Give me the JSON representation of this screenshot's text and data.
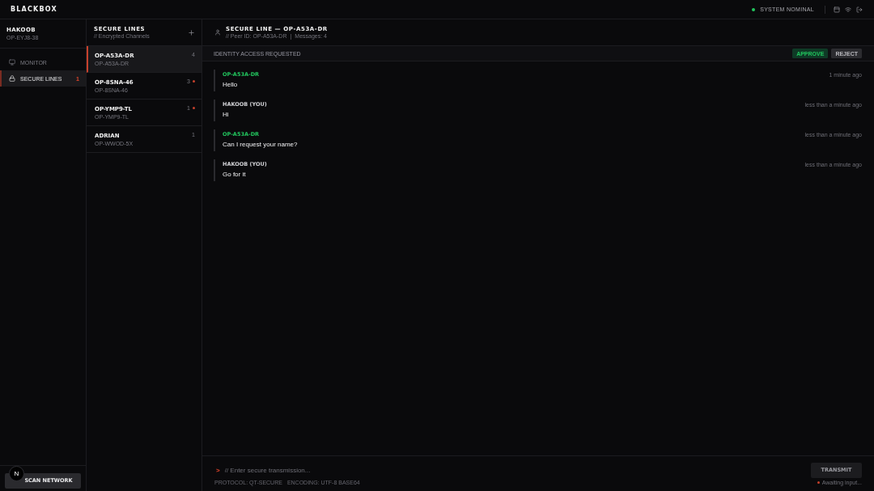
{
  "top_bar": {
    "logo": "BLACKBOX",
    "status": "SYSTEM NOMINAL"
  },
  "user": {
    "name": "HAKOOB",
    "id": "OP-EYJ8-38"
  },
  "nav": [
    {
      "label": "MONITOR",
      "kind": "monitor",
      "selected": false
    },
    {
      "label": "SECURE LINES",
      "kind": "lock",
      "selected": true,
      "badge": "1"
    }
  ],
  "scan_button": "SCAN NETWORK",
  "dev_indicator": "N",
  "channels": {
    "title": "SECURE LINES",
    "subtitle": "// Encrypted Channels",
    "items": [
      {
        "name": "OP-A53A-DR",
        "peer_id": "OP-A53A-DR",
        "count": "4",
        "unread": false,
        "selected": true
      },
      {
        "name": "OP-8SNA-46",
        "peer_id": "OP-8SNA-46",
        "count": "3",
        "unread": true,
        "selected": false
      },
      {
        "name": "OP-YMP9-TL",
        "peer_id": "OP-YMP9-TL",
        "count": "1",
        "unread": true,
        "selected": false
      },
      {
        "name": "ADRIAN",
        "peer_id": "OP-WWOD-5X",
        "count": "1",
        "unread": false,
        "selected": false
      }
    ]
  },
  "conversation": {
    "title": "SECURE LINE — OP-A53A-DR",
    "peer_info": "// Peer ID: OP-A53A-DR",
    "separator": "|",
    "message_count": "Messages: 4"
  },
  "request": {
    "label": "IDENTITY ACCESS REQUESTED",
    "buttons": [
      {
        "label": "APPROVE",
        "kind": "approve"
      },
      {
        "label": "REJECT",
        "kind": "reject"
      }
    ]
  },
  "messages": [
    {
      "sender": "OP-A53A-DR",
      "text": "Hello",
      "time": "1 minute ago",
      "from_self": false
    },
    {
      "sender": "HAKOOB (YOU)",
      "text": "Hi",
      "time": "less than a minute ago",
      "from_self": true
    },
    {
      "sender": "OP-A53A-DR",
      "text": "Can I request your name?",
      "time": "less than a minute ago",
      "from_self": false
    },
    {
      "sender": "HAKOOB (YOU)",
      "text": "Go for it",
      "time": "less than a minute ago",
      "from_self": true
    }
  ],
  "composer": {
    "prompt": ">",
    "placeholder": "// Enter secure transmission...",
    "button": "TRANSMIT",
    "protocol": "PROTOCOL: QT-SECURE",
    "encoding": "ENCODING: UTF-8 BASE64",
    "status": "Awaiting input..."
  }
}
